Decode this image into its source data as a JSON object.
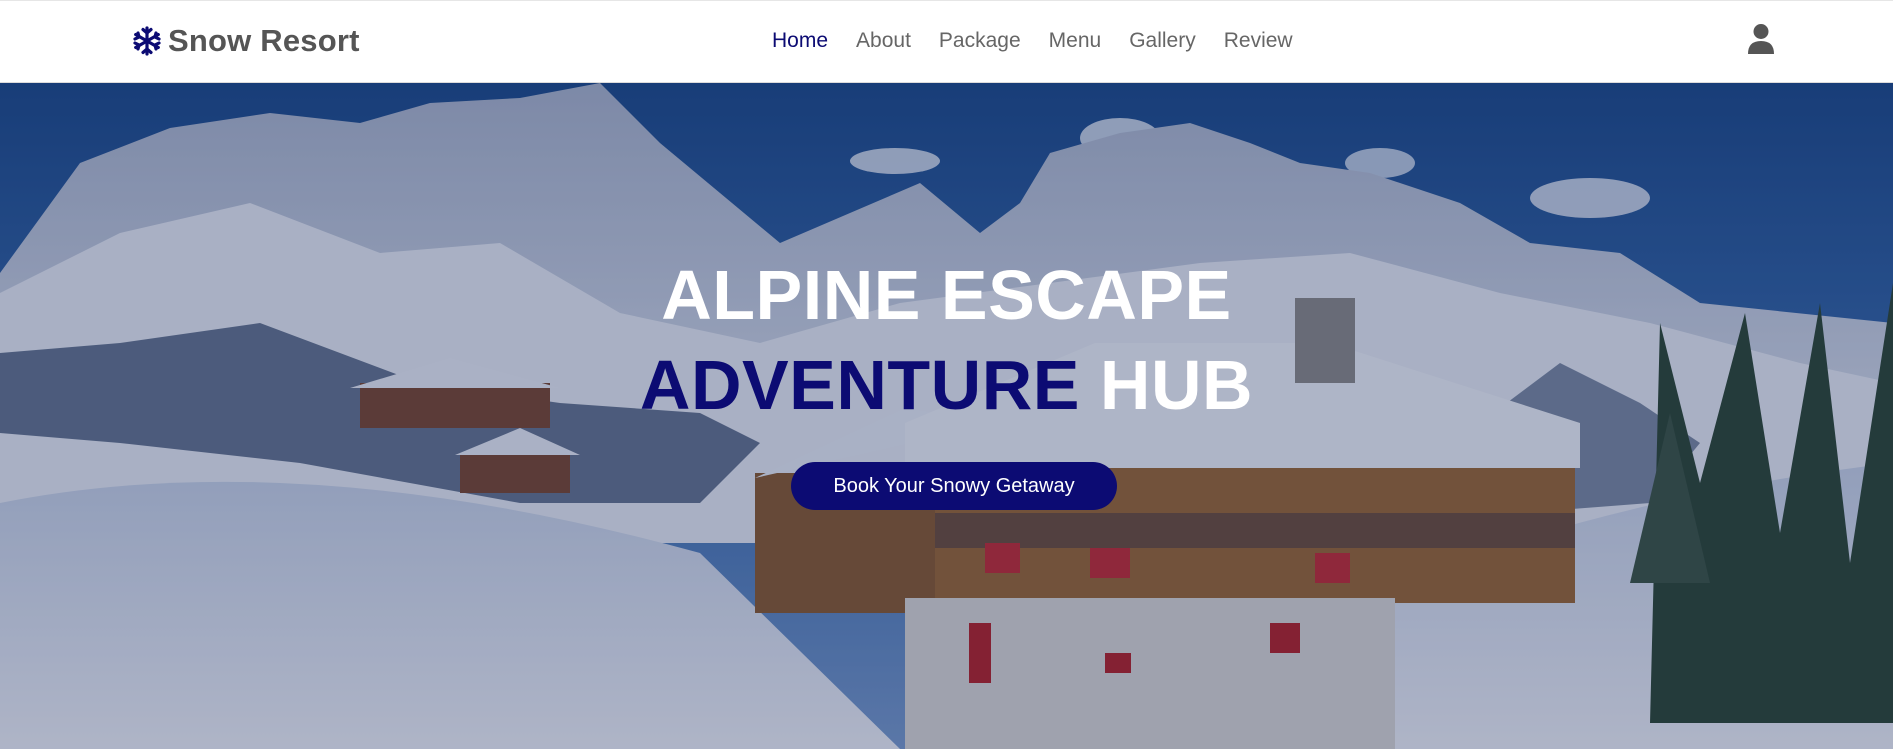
{
  "brand": {
    "name": "Snow Resort",
    "icon": "snowflake-icon"
  },
  "nav": {
    "items": [
      {
        "label": "Home",
        "active": true
      },
      {
        "label": "About",
        "active": false
      },
      {
        "label": "Package",
        "active": false
      },
      {
        "label": "Menu",
        "active": false
      },
      {
        "label": "Gallery",
        "active": false
      },
      {
        "label": "Review",
        "active": false
      }
    ],
    "user_icon": "user-icon"
  },
  "hero": {
    "title_line1": "ALPINE ESCAPE",
    "title_line2_accent": "ADVENTURE",
    "title_line2_rest": " HUB",
    "cta_label": "Book Your Snowy Getaway"
  },
  "colors": {
    "accent": "#0c0b73",
    "nav_text": "#666666",
    "brand_text": "#555555"
  }
}
